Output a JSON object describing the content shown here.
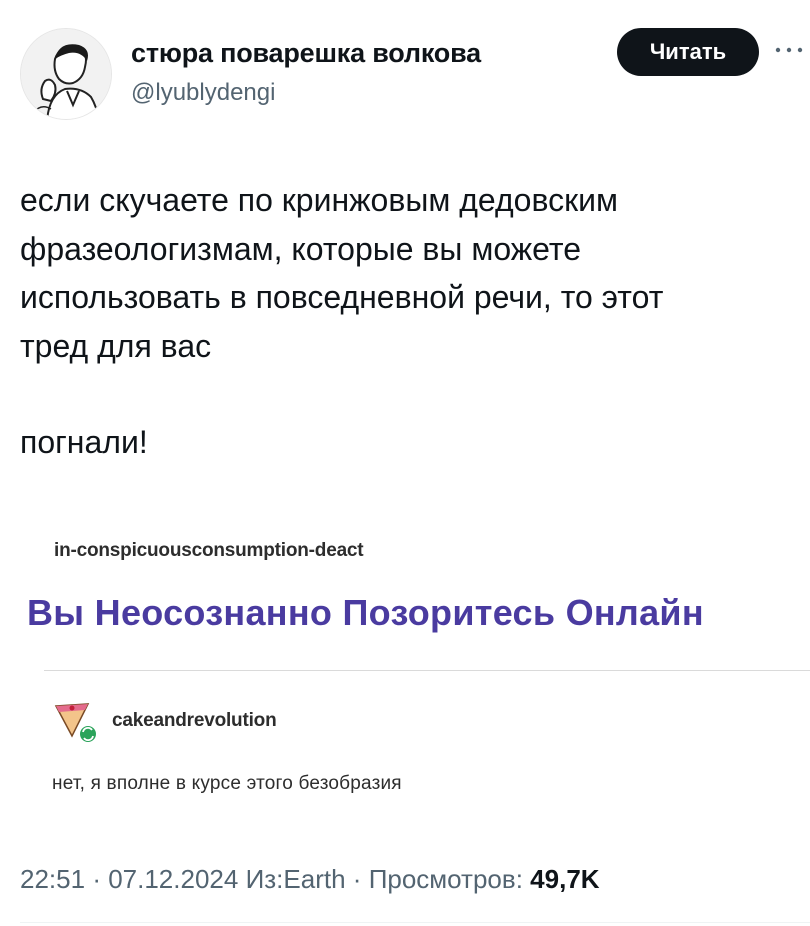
{
  "author": {
    "display_name": "стюра поварешка волкова",
    "handle": "@lyublydengi"
  },
  "follow_button": {
    "label": "Читать"
  },
  "tweet": {
    "lines": [
      "если скучаете по кринжовым дедовским",
      "фразеологизмам, которые вы можете",
      "использовать в повседневной речи, то этот",
      "тред для вас"
    ],
    "outro": "погнали!"
  },
  "embedded_post": {
    "original_user": "in-conspicuousconsumption-deact",
    "title": "Вы Неосознанно Позоритесь Онлайн",
    "reblog_user": "cakeandrevolution",
    "reply": "нет, я вполне в курсе этого безобразия"
  },
  "meta": {
    "time": "22:51",
    "date": "07.12.2024",
    "source": "Из:Earth",
    "views_label": "Просмотров:",
    "views_count": "49,7K"
  }
}
